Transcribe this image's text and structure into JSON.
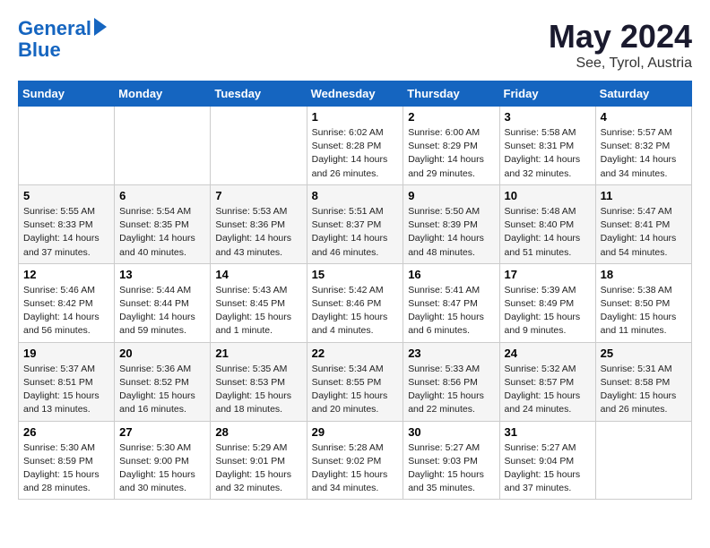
{
  "logo": {
    "line1": "General",
    "line2": "Blue"
  },
  "title": "May 2024",
  "subtitle": "See, Tyrol, Austria",
  "headers": [
    "Sunday",
    "Monday",
    "Tuesday",
    "Wednesday",
    "Thursday",
    "Friday",
    "Saturday"
  ],
  "weeks": [
    [
      {
        "day": "",
        "info": ""
      },
      {
        "day": "",
        "info": ""
      },
      {
        "day": "",
        "info": ""
      },
      {
        "day": "1",
        "info": "Sunrise: 6:02 AM\nSunset: 8:28 PM\nDaylight: 14 hours\nand 26 minutes."
      },
      {
        "day": "2",
        "info": "Sunrise: 6:00 AM\nSunset: 8:29 PM\nDaylight: 14 hours\nand 29 minutes."
      },
      {
        "day": "3",
        "info": "Sunrise: 5:58 AM\nSunset: 8:31 PM\nDaylight: 14 hours\nand 32 minutes."
      },
      {
        "day": "4",
        "info": "Sunrise: 5:57 AM\nSunset: 8:32 PM\nDaylight: 14 hours\nand 34 minutes."
      }
    ],
    [
      {
        "day": "5",
        "info": "Sunrise: 5:55 AM\nSunset: 8:33 PM\nDaylight: 14 hours\nand 37 minutes."
      },
      {
        "day": "6",
        "info": "Sunrise: 5:54 AM\nSunset: 8:35 PM\nDaylight: 14 hours\nand 40 minutes."
      },
      {
        "day": "7",
        "info": "Sunrise: 5:53 AM\nSunset: 8:36 PM\nDaylight: 14 hours\nand 43 minutes."
      },
      {
        "day": "8",
        "info": "Sunrise: 5:51 AM\nSunset: 8:37 PM\nDaylight: 14 hours\nand 46 minutes."
      },
      {
        "day": "9",
        "info": "Sunrise: 5:50 AM\nSunset: 8:39 PM\nDaylight: 14 hours\nand 48 minutes."
      },
      {
        "day": "10",
        "info": "Sunrise: 5:48 AM\nSunset: 8:40 PM\nDaylight: 14 hours\nand 51 minutes."
      },
      {
        "day": "11",
        "info": "Sunrise: 5:47 AM\nSunset: 8:41 PM\nDaylight: 14 hours\nand 54 minutes."
      }
    ],
    [
      {
        "day": "12",
        "info": "Sunrise: 5:46 AM\nSunset: 8:42 PM\nDaylight: 14 hours\nand 56 minutes."
      },
      {
        "day": "13",
        "info": "Sunrise: 5:44 AM\nSunset: 8:44 PM\nDaylight: 14 hours\nand 59 minutes."
      },
      {
        "day": "14",
        "info": "Sunrise: 5:43 AM\nSunset: 8:45 PM\nDaylight: 15 hours\nand 1 minute."
      },
      {
        "day": "15",
        "info": "Sunrise: 5:42 AM\nSunset: 8:46 PM\nDaylight: 15 hours\nand 4 minutes."
      },
      {
        "day": "16",
        "info": "Sunrise: 5:41 AM\nSunset: 8:47 PM\nDaylight: 15 hours\nand 6 minutes."
      },
      {
        "day": "17",
        "info": "Sunrise: 5:39 AM\nSunset: 8:49 PM\nDaylight: 15 hours\nand 9 minutes."
      },
      {
        "day": "18",
        "info": "Sunrise: 5:38 AM\nSunset: 8:50 PM\nDaylight: 15 hours\nand 11 minutes."
      }
    ],
    [
      {
        "day": "19",
        "info": "Sunrise: 5:37 AM\nSunset: 8:51 PM\nDaylight: 15 hours\nand 13 minutes."
      },
      {
        "day": "20",
        "info": "Sunrise: 5:36 AM\nSunset: 8:52 PM\nDaylight: 15 hours\nand 16 minutes."
      },
      {
        "day": "21",
        "info": "Sunrise: 5:35 AM\nSunset: 8:53 PM\nDaylight: 15 hours\nand 18 minutes."
      },
      {
        "day": "22",
        "info": "Sunrise: 5:34 AM\nSunset: 8:55 PM\nDaylight: 15 hours\nand 20 minutes."
      },
      {
        "day": "23",
        "info": "Sunrise: 5:33 AM\nSunset: 8:56 PM\nDaylight: 15 hours\nand 22 minutes."
      },
      {
        "day": "24",
        "info": "Sunrise: 5:32 AM\nSunset: 8:57 PM\nDaylight: 15 hours\nand 24 minutes."
      },
      {
        "day": "25",
        "info": "Sunrise: 5:31 AM\nSunset: 8:58 PM\nDaylight: 15 hours\nand 26 minutes."
      }
    ],
    [
      {
        "day": "26",
        "info": "Sunrise: 5:30 AM\nSunset: 8:59 PM\nDaylight: 15 hours\nand 28 minutes."
      },
      {
        "day": "27",
        "info": "Sunrise: 5:30 AM\nSunset: 9:00 PM\nDaylight: 15 hours\nand 30 minutes."
      },
      {
        "day": "28",
        "info": "Sunrise: 5:29 AM\nSunset: 9:01 PM\nDaylight: 15 hours\nand 32 minutes."
      },
      {
        "day": "29",
        "info": "Sunrise: 5:28 AM\nSunset: 9:02 PM\nDaylight: 15 hours\nand 34 minutes."
      },
      {
        "day": "30",
        "info": "Sunrise: 5:27 AM\nSunset: 9:03 PM\nDaylight: 15 hours\nand 35 minutes."
      },
      {
        "day": "31",
        "info": "Sunrise: 5:27 AM\nSunset: 9:04 PM\nDaylight: 15 hours\nand 37 minutes."
      },
      {
        "day": "",
        "info": ""
      }
    ]
  ]
}
